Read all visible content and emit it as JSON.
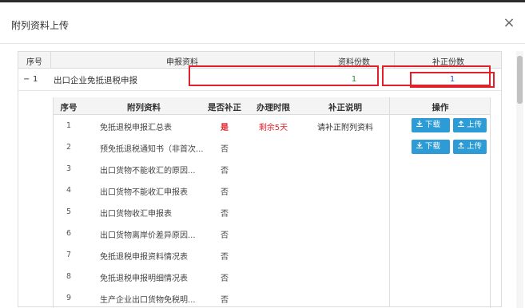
{
  "dialog": {
    "title": "附列资料上传",
    "close": "×"
  },
  "outer_table": {
    "headers": [
      "序号",
      "申报资料",
      "资料份数",
      "补正份数"
    ],
    "rows": [
      {
        "toggle": "−",
        "seq": "1",
        "name": "出口企业免抵退税申报",
        "count": "1",
        "supplement": "1"
      }
    ]
  },
  "inner_table": {
    "headers": [
      "序号",
      "附列资料",
      "是否补正",
      "办理时限",
      "补正说明",
      "操作"
    ],
    "rows": [
      {
        "seq": "1",
        "material": "免抵退税申报汇总表",
        "need": "是",
        "limit": "剩余5天",
        "note": "请补正附列资料",
        "buttons": true
      },
      {
        "seq": "2",
        "material": "预免抵退税通知书（非首次...",
        "need": "否",
        "limit": "",
        "note": "",
        "buttons": true
      },
      {
        "seq": "3",
        "material": "出口货物不能收汇的原因...",
        "need": "否",
        "limit": "",
        "note": "",
        "buttons": false
      },
      {
        "seq": "4",
        "material": "出口货物不能收汇申报表",
        "need": "否",
        "limit": "",
        "note": "",
        "buttons": false
      },
      {
        "seq": "5",
        "material": "出口货物收汇申报表",
        "need": "否",
        "limit": "",
        "note": "",
        "buttons": false
      },
      {
        "seq": "6",
        "material": "出口货物离岸价差异原因...",
        "need": "否",
        "limit": "",
        "note": "",
        "buttons": false
      },
      {
        "seq": "7",
        "material": "免抵退税申报资料情况表",
        "need": "否",
        "limit": "",
        "note": "",
        "buttons": false
      },
      {
        "seq": "8",
        "material": "免抵退税申报明细情况表",
        "need": "否",
        "limit": "",
        "note": "",
        "buttons": false
      },
      {
        "seq": "9",
        "material": "生产企业出口货物免税明...",
        "need": "否",
        "limit": "",
        "note": "",
        "buttons": false
      }
    ],
    "download_label": "下载",
    "upload_label": "上传"
  },
  "colors": {
    "accent": "#2d9bd6",
    "highlight_red": "#e0202a",
    "count_green": "#2e8b2e",
    "supplement_blue": "#2a54c8"
  },
  "icons": [
    "close-icon",
    "download-icon",
    "upload-icon",
    "collapse-icon"
  ]
}
